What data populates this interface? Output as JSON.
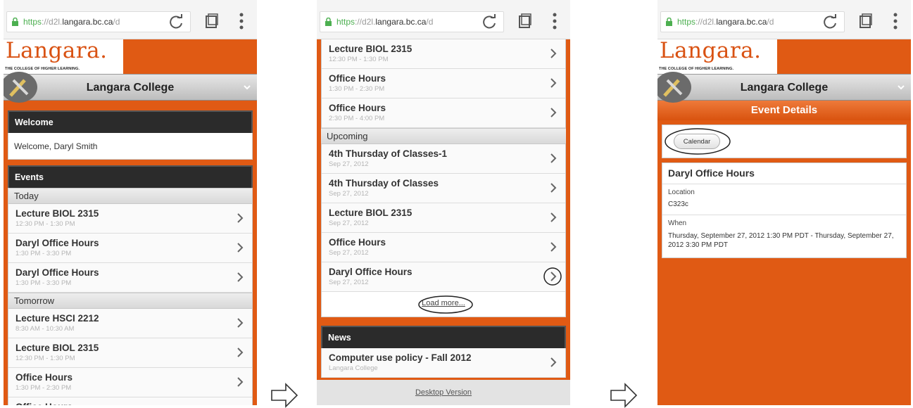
{
  "browser": {
    "url_scheme": "https",
    "url_sep": "://d2l.",
    "url_host": "langara.bc.ca",
    "url_tail": "/d"
  },
  "header": {
    "logo": "Langara.",
    "logo_tagline": "THE COLLEGE OF HIGHER LEARNING.",
    "college_title": "Langara College"
  },
  "screen1": {
    "welcome_heading": "Welcome",
    "welcome_text": "Welcome, Daryl Smith",
    "events_heading": "Events",
    "groups": [
      {
        "label": "Today",
        "items": [
          {
            "title": "Lecture BIOL 2315",
            "time": "12:30 PM - 1:30 PM"
          },
          {
            "title": "Daryl Office Hours",
            "time": "1:30 PM - 3:30 PM"
          },
          {
            "title": "Daryl Office Hours",
            "time": "1:30 PM - 3:30 PM"
          }
        ]
      },
      {
        "label": "Tomorrow",
        "items": [
          {
            "title": "Lecture HSCI 2212",
            "time": "8:30 AM - 10:30 AM"
          },
          {
            "title": "Lecture BIOL 2315",
            "time": "12:30 PM - 1:30 PM"
          },
          {
            "title": "Office Hours",
            "time": "1:30 PM - 2:30 PM"
          },
          {
            "title": "Office Hours",
            "time": ""
          }
        ]
      }
    ]
  },
  "screen2": {
    "top_items": [
      {
        "title": "Lecture BIOL 2315",
        "time": "12:30 PM - 1:30 PM"
      },
      {
        "title": "Office Hours",
        "time": "1:30 PM - 2:30 PM"
      },
      {
        "title": "Office Hours",
        "time": "2:30 PM - 4:00 PM"
      }
    ],
    "upcoming_label": "Upcoming",
    "upcoming_items": [
      {
        "title": "4th Thursday of Classes-1",
        "time": "Sep 27, 2012"
      },
      {
        "title": "4th Thursday of Classes",
        "time": "Sep 27, 2012"
      },
      {
        "title": "Lecture BIOL 2315",
        "time": "Sep 27, 2012"
      },
      {
        "title": "Office Hours",
        "time": "Sep 27, 2012"
      },
      {
        "title": "Daryl Office Hours",
        "time": "Sep 27, 2012"
      }
    ],
    "load_more": "Load more...",
    "news_heading": "News",
    "news_items": [
      {
        "title": "Computer use policy - Fall 2012",
        "time": "Langara College"
      }
    ],
    "desktop_link": "Desktop Version"
  },
  "screen3": {
    "event_details_heading": "Event Details",
    "calendar_button": "Calendar",
    "event_title": "Daryl Office Hours",
    "location_label": "Location",
    "location_value": "C323c",
    "when_label": "When",
    "when_value": "Thursday, September 27, 2012 1:30 PM PDT - Thursday, September 27, 2012 3:30 PM PDT"
  },
  "colors": {
    "brand_orange": "#e05a14",
    "header_dark": "#2b2b2b"
  }
}
